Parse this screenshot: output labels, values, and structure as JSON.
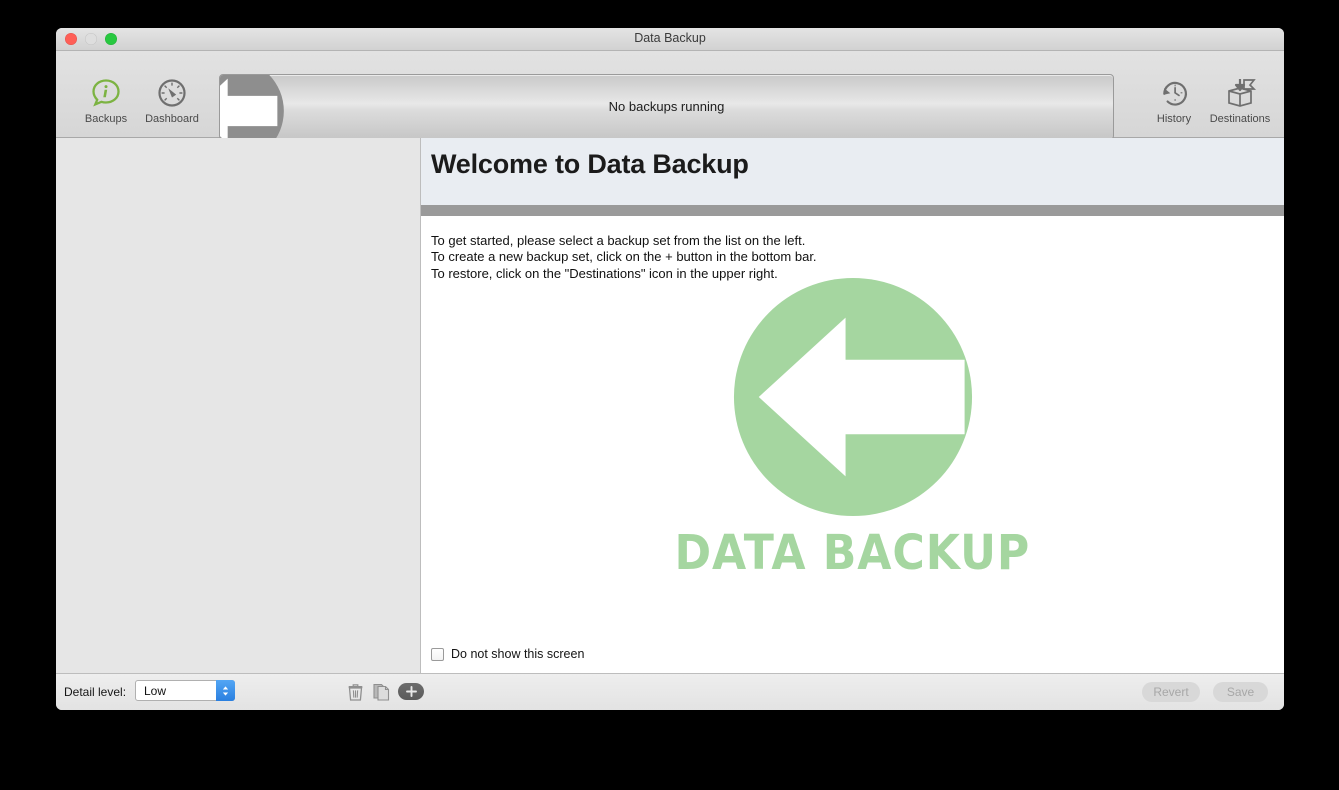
{
  "window": {
    "title": "Data Backup",
    "traffic_lights": [
      "close",
      "minimize",
      "zoom"
    ]
  },
  "toolbar": {
    "left_items": [
      {
        "label": "Backups",
        "icon": "info-bubble-icon"
      },
      {
        "label": "Dashboard",
        "icon": "gauge-icon"
      }
    ],
    "right_items": [
      {
        "label": "History",
        "icon": "clock-rewind-icon"
      },
      {
        "label": "Destinations",
        "icon": "box-download-icon"
      }
    ],
    "status_text": "No backups running",
    "status_icon": "backup-arrow-icon"
  },
  "content": {
    "page_title": "Welcome to Data Backup",
    "instructions": [
      "To get started, please select a backup set from the list on the left.",
      "To create a new backup set, click on the + button in the bottom bar.",
      "To restore, click on the \"Destinations\" icon in the upper right."
    ],
    "brand_word": "DATA BACKUP",
    "brand_icon": "backup-arrow-icon",
    "dont_show_label": "Do not show this screen",
    "dont_show_checked": false
  },
  "bottom_bar": {
    "detail_label": "Detail level:",
    "detail_value": "Low",
    "detail_options": [
      "Low"
    ],
    "delete_icon": "trash-icon",
    "duplicate_icon": "duplicate-icon",
    "add_icon": "plus-icon",
    "revert_label": "Revert",
    "save_label": "Save",
    "revert_enabled": false,
    "save_enabled": false
  },
  "colors": {
    "brand_green": "#a5d6a0",
    "accent_blue": "#2a7fe0",
    "toolbar_gray": "#d6d6d6",
    "sidebar_gray": "#e6e6e6",
    "header_band": "#e9edf2",
    "header_rule": "#9a9a9a"
  }
}
